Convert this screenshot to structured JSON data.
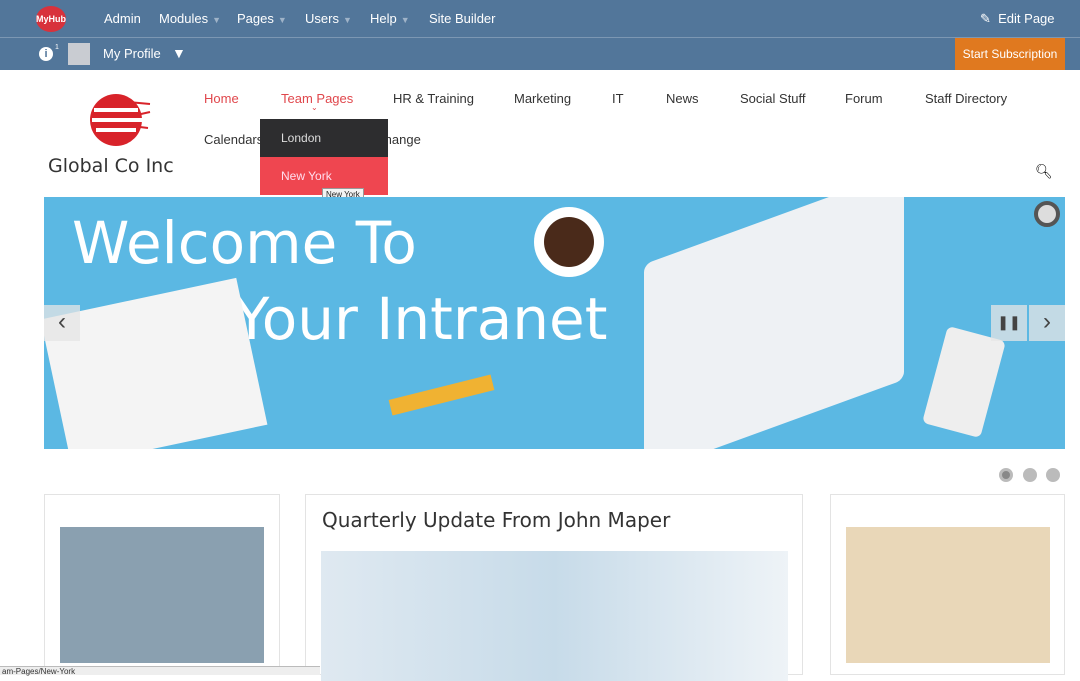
{
  "topbar": {
    "logo": "MyHub",
    "items": [
      {
        "label": "Admin"
      },
      {
        "label": "Modules",
        "dropdown": true
      },
      {
        "label": "Pages",
        "dropdown": true
      },
      {
        "label": "Users",
        "dropdown": true
      },
      {
        "label": "Help",
        "dropdown": true
      },
      {
        "label": "Site Builder"
      }
    ],
    "edit_page": "Edit Page"
  },
  "subbar": {
    "profile": "My Profile",
    "subscribe": "Start Subscription",
    "info_badge": "1"
  },
  "brand": {
    "name": "Global Co Inc",
    "color": "#d8232a"
  },
  "nav": {
    "items": [
      "Home",
      "Team Pages",
      "HR & Training",
      "Marketing",
      "IT",
      "News",
      "Social Stuff",
      "Forum",
      "Staff Directory",
      "Calendars",
      "Exchange"
    ],
    "active_color": "#e0474c"
  },
  "dropdown": {
    "items": [
      "London",
      "New York"
    ],
    "hovered": "New York",
    "tooltip": "New York"
  },
  "hero": {
    "line1": "Welcome To",
    "line2": "Your Intranet",
    "slide": 1,
    "slides": 3
  },
  "cards": {
    "middle_title": "Quarterly Update From John Maper"
  },
  "statusbar": {
    "url": "am-Pages/New-York"
  }
}
